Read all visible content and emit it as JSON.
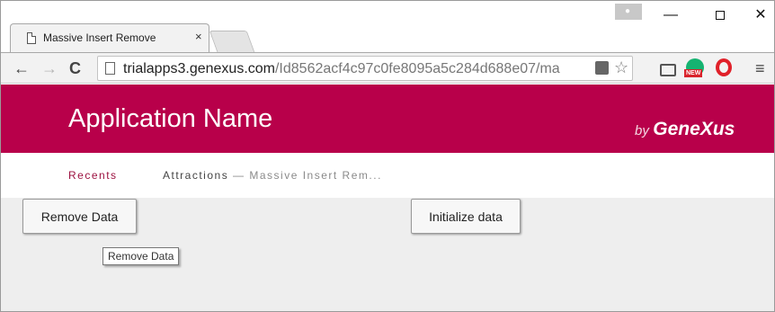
{
  "browser": {
    "tab_title": "Massive Insert Remove",
    "tab_close": "×",
    "window_controls": {
      "minimize": "—",
      "maximize": "",
      "close": "✕"
    },
    "nav": {
      "back": "←",
      "forward": "→",
      "reload": "C"
    },
    "address": {
      "host": "trialapps3.genexus.com",
      "path": "/Id8562acf4c97c0fe8095a5c284d688e07/ma"
    },
    "star": "☆",
    "menu": "≡"
  },
  "app": {
    "name": "Application Name",
    "by": "by",
    "brand": "GeneXus",
    "breadcrumbs": {
      "recents": "Recents",
      "current": "Attractions",
      "current_sub": " — Massive Insert Rem..."
    },
    "buttons": {
      "remove_data": "Remove Data",
      "initialize_data": "Initialize data"
    },
    "tooltip": "Remove Data"
  },
  "colors": {
    "header": "#b8004a",
    "breadcrumb_link": "#9c1140",
    "content_bg": "#eeeeee"
  }
}
